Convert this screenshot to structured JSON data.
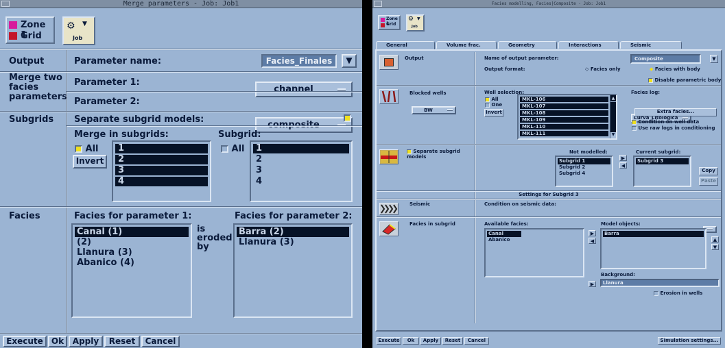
{
  "left": {
    "title": "Merge parameters - Job: Job1",
    "zone_label": "Zone 1",
    "grid_label": "Grid",
    "job_label": "Job",
    "output": {
      "section": "Output",
      "param_name_label": "Parameter name:",
      "param_name_value": "Facies_Finales"
    },
    "merge": {
      "section": "Merge two facies parameters",
      "p1_label": "Parameter 1:",
      "p1_value": "channel",
      "p2_label": "Parameter 2:",
      "p2_value": "composite"
    },
    "subgrids": {
      "section": "Subgrids",
      "separate_label": "Separate subgrid models:",
      "merge_in_label": "Merge in subgrids:",
      "all_label": "All",
      "invert_label": "Invert",
      "merge_items": [
        "1",
        "2",
        "3",
        "4"
      ],
      "subgrid_label": "Subgrid:",
      "subgrid_all_label": "All",
      "subgrid_items": [
        "1",
        "2",
        "3",
        "4"
      ]
    },
    "facies": {
      "section": "Facies",
      "for_p1_label": "Facies for parameter 1:",
      "for_p2_label": "Facies for parameter 2:",
      "eroded_label": "is eroded by",
      "p1_items": [
        "Canal (1)",
        "(2)",
        "Llanura (3)",
        "Abanico (4)"
      ],
      "p2_items": [
        "Barra (2)",
        "Llanura (3)"
      ]
    },
    "footer": [
      "Execute",
      "Ok",
      "Apply",
      "Reset",
      "Cancel"
    ]
  },
  "right": {
    "title": "Facies modelling, Facies|Composite - Job: Job1",
    "zone_label": "Zone 1",
    "grid_label": "Grid",
    "job_label": "Job",
    "tabs": [
      "General",
      "Volume frac.",
      "Geometry",
      "Interactions",
      "Seismic"
    ],
    "output": {
      "label": "Output",
      "name_label": "Name of output parameter:",
      "name_value": "Composite",
      "format_label": "Output format:",
      "facies_only": "Facies only",
      "facies_body": "Facies with body",
      "disable_label": "Disable parametric body"
    },
    "wells": {
      "label": "Blocked wells",
      "dropdown": "BW",
      "selection_label": "Well selection:",
      "all_label": "All",
      "one_label": "One",
      "invert_label": "Invert",
      "items": [
        "MKL-106",
        "MKL-107",
        "MKL-108",
        "MKL-109",
        "MKL-110",
        "MKL-111"
      ],
      "facies_log_label": "Facies log:",
      "facies_log_value": "Curva_Litologica",
      "extra_label": "Extra facies...",
      "cond_well": "Condition on well data",
      "use_raw": "Use raw logs in conditioning"
    },
    "subgrid": {
      "separate_label": "Separate subgrid models",
      "not_modelled_label": "Not modelled:",
      "not_modelled": [
        "Subgrid 1",
        "Subgrid 2",
        "Subgrid 4"
      ],
      "current_label": "Current subgrid:",
      "current": [
        "Subgrid 3"
      ],
      "copy": "Copy",
      "paste": "Paste",
      "settings_label": "Settings for Subgrid 3"
    },
    "seismic": {
      "label": "Seismic",
      "cond_label": "Condition on seismic data:"
    },
    "facies": {
      "label": "Facies in subgrid",
      "available_label": "Available facies:",
      "available": [
        "Canal",
        "Abanico"
      ],
      "model_label": "Model objects:",
      "model": [
        "Barra"
      ],
      "background_label": "Background:",
      "background_value": "Llanura",
      "erosion_label": "Erosion in wells"
    },
    "footer": [
      "Execute",
      "Ok",
      "Apply",
      "Reset",
      "Cancel"
    ],
    "sim_settings": "Simulation settings..."
  },
  "colors": {
    "panel": "#9bb4d3",
    "selection": "#061226",
    "zone": "#d81b9c",
    "grid": "#c4162a",
    "check": "#f0e020"
  }
}
